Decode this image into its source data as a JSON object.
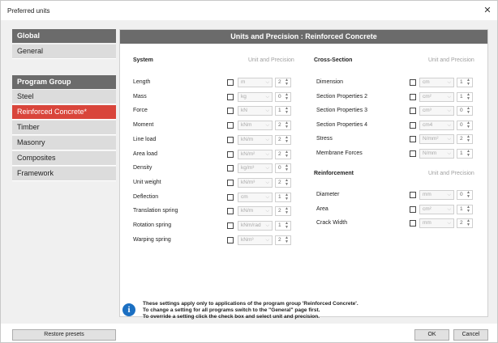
{
  "window": {
    "title": "Preferred units",
    "close_glyph": "✕"
  },
  "sidebar": {
    "global_header": "Global",
    "global_items": [
      {
        "label": "General"
      }
    ],
    "program_header": "Program Group",
    "program_items": [
      {
        "label": "Steel"
      },
      {
        "label": "Reinforced Concrete*",
        "active": true
      },
      {
        "label": "Timber"
      },
      {
        "label": "Masonry"
      },
      {
        "label": "Composites"
      },
      {
        "label": "Framework"
      }
    ]
  },
  "main": {
    "header": "Units and Precision : Reinforced Concrete",
    "system": {
      "title": "System",
      "subtitle": "Unit and Precision",
      "rows": [
        {
          "label": "Length",
          "unit": "m",
          "precision": "2"
        },
        {
          "label": "Mass",
          "unit": "kg",
          "precision": "0"
        },
        {
          "label": "Force",
          "unit": "kN",
          "precision": "1"
        },
        {
          "label": "Moment",
          "unit": "kNm",
          "precision": "2"
        },
        {
          "label": "Line load",
          "unit": "kN/m",
          "precision": "2"
        },
        {
          "label": "Area load",
          "unit": "kN/m²",
          "precision": "2"
        },
        {
          "label": "Density",
          "unit": "kg/m³",
          "precision": "0"
        },
        {
          "label": "Unit weight",
          "unit": "kN/m³",
          "precision": "2"
        },
        {
          "label": "Deflection",
          "unit": "cm",
          "precision": "1"
        },
        {
          "label": "Translation spring",
          "unit": "kN/m",
          "precision": "2"
        },
        {
          "label": "Rotation spring",
          "unit": "kNm/rad",
          "precision": "1"
        },
        {
          "label": "Warping spring",
          "unit": "kNm³",
          "precision": "2"
        }
      ]
    },
    "cross_section": {
      "title": "Cross-Section",
      "subtitle": "Unit and Precision",
      "rows": [
        {
          "label": "Dimension",
          "unit": "cm",
          "precision": "1"
        },
        {
          "label": "Section Properties 2",
          "unit": "cm²",
          "precision": "1"
        },
        {
          "label": "Section Properties 3",
          "unit": "cm³",
          "precision": "0"
        },
        {
          "label": "Section Properties 4",
          "unit": "cm4",
          "precision": "0"
        },
        {
          "label": "Stress",
          "unit": "N/mm²",
          "precision": "2"
        },
        {
          "label": "Membrane Forces",
          "unit": "N/mm",
          "precision": "1"
        }
      ]
    },
    "reinforcement": {
      "title": "Reinforcement",
      "subtitle": "Unit and Precision",
      "rows": [
        {
          "label": "Diameter",
          "unit": "mm",
          "precision": "0"
        },
        {
          "label": "Area",
          "unit": "cm²",
          "precision": "1"
        },
        {
          "label": "Crack Width",
          "unit": "mm",
          "precision": "2"
        }
      ]
    },
    "info": {
      "icon": "i",
      "lines": [
        "These settings apply only to applications of the program group 'Reinforced Concrete'.",
        "To change a setting for all programs switch to the \"General\" page first.",
        "To override a setting click the check box and select unit and precision."
      ]
    }
  },
  "footer": {
    "restore_label": "Restore presets",
    "ok_label": "OK",
    "cancel_label": "Cancel"
  },
  "colors": {
    "header_bg": "#6b6b6b",
    "active_item": "#d9453b",
    "info_icon": "#1b6fc2"
  }
}
